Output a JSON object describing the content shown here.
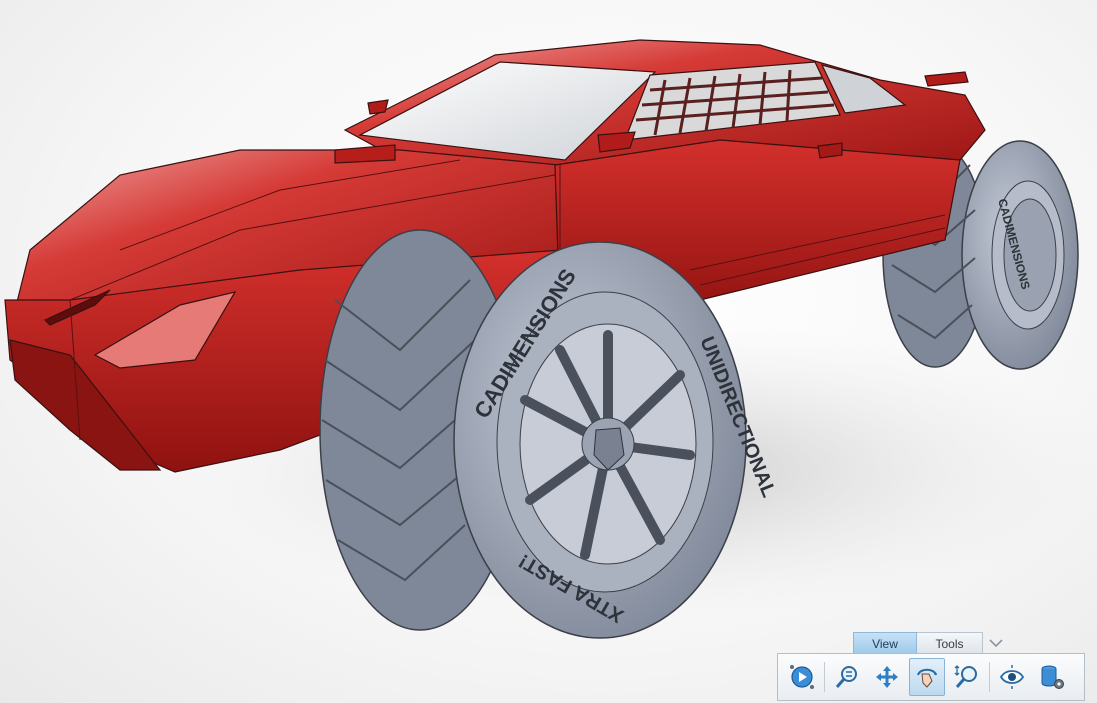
{
  "viewport": {
    "scene": "3D model of a red sports car body on oversized tires",
    "colors": {
      "body": "#c8201f",
      "tire": "#9ba3b3",
      "wire": "#3a1010"
    }
  },
  "tire_text": {
    "brand": "CADIMENSIONS",
    "direction": "UNIDIRECTIONAL",
    "slogan": "XTRA FAST!"
  },
  "action_bar": {
    "tabs": [
      {
        "label": "View",
        "active": true
      },
      {
        "label": "Tools",
        "active": false
      }
    ],
    "collapse_icon": "chevron-down-icon",
    "tools": [
      {
        "icon": "fly-through-icon",
        "active": false
      },
      {
        "icon": "zoom-fit-icon",
        "active": false
      },
      {
        "icon": "pan-icon",
        "active": false
      },
      {
        "icon": "rotate-icon",
        "active": true
      },
      {
        "icon": "zoom-icon",
        "active": false
      },
      {
        "icon": "normal-view-icon",
        "active": false
      },
      {
        "icon": "database-settings-icon",
        "active": false
      }
    ]
  }
}
